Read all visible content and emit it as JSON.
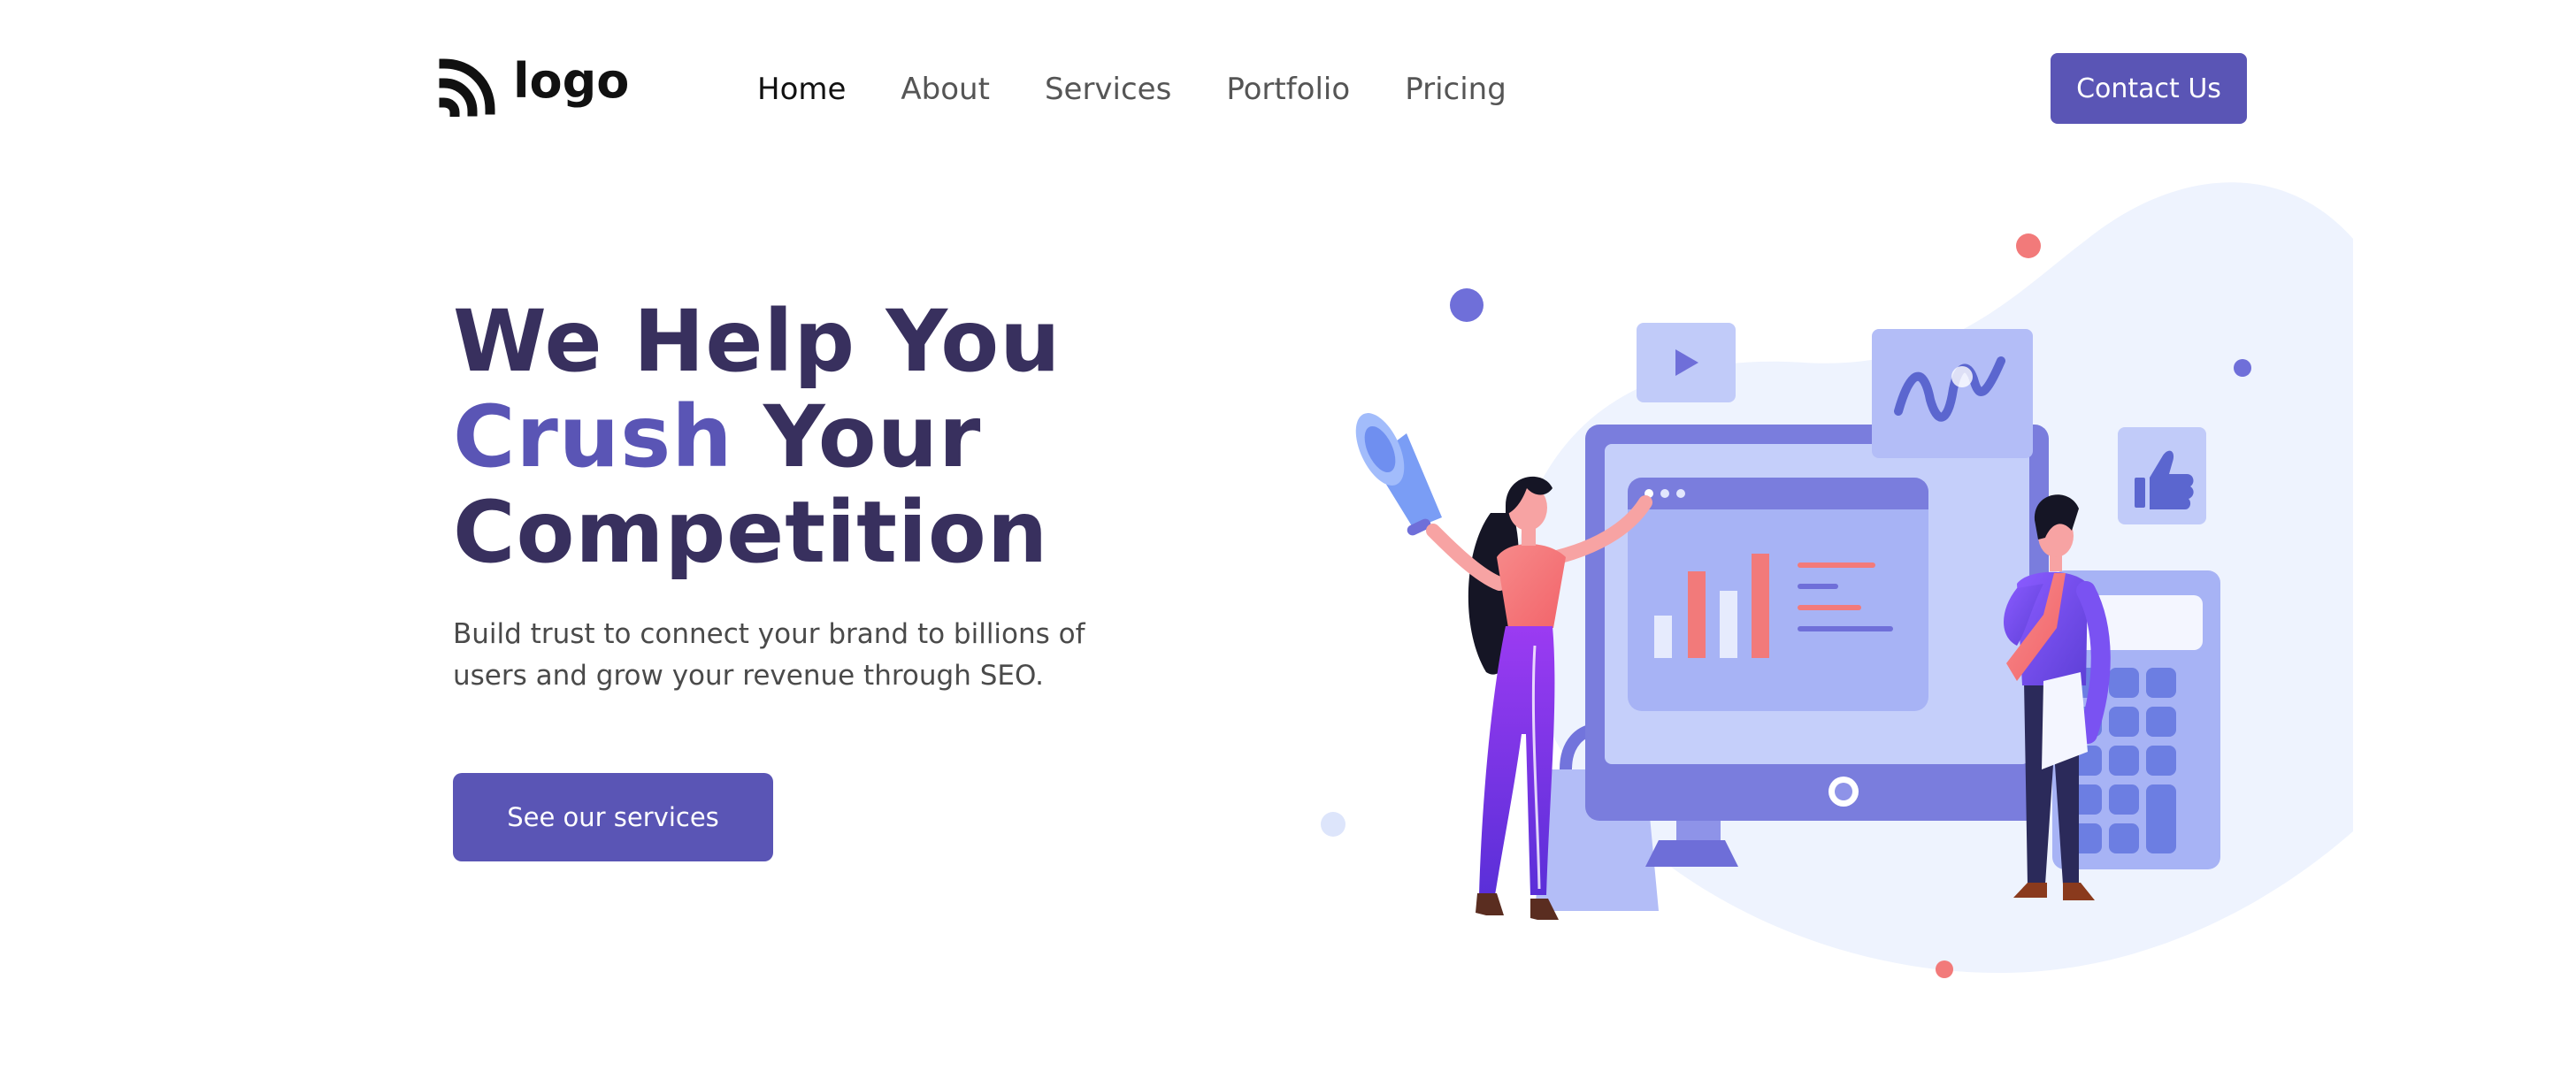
{
  "header": {
    "logo_text": "logo",
    "nav": {
      "home": "Home",
      "about": "About",
      "services": "Services",
      "portfolio": "Portfolio",
      "pricing": "Pricing"
    },
    "contact_label": "Contact Us"
  },
  "hero": {
    "title_line1": "We Help You",
    "title_accent": "Crush",
    "title_line2_rest": " Your",
    "title_line3": "Competition",
    "subtitle": "Build trust to connect your brand to billions of users and grow your revenue through SEO.",
    "cta_label": "See our services"
  },
  "colors": {
    "brand": "#5a55b5",
    "heading": "#38305e",
    "accent_pink": "#f27a7a",
    "illustration_light": "#eef3fe"
  },
  "icons": [
    "logo-mark-icon",
    "play-icon",
    "wave-chart-icon",
    "thumbs-up-icon",
    "megaphone-icon",
    "calculator-icon",
    "shopping-bag-icon"
  ]
}
